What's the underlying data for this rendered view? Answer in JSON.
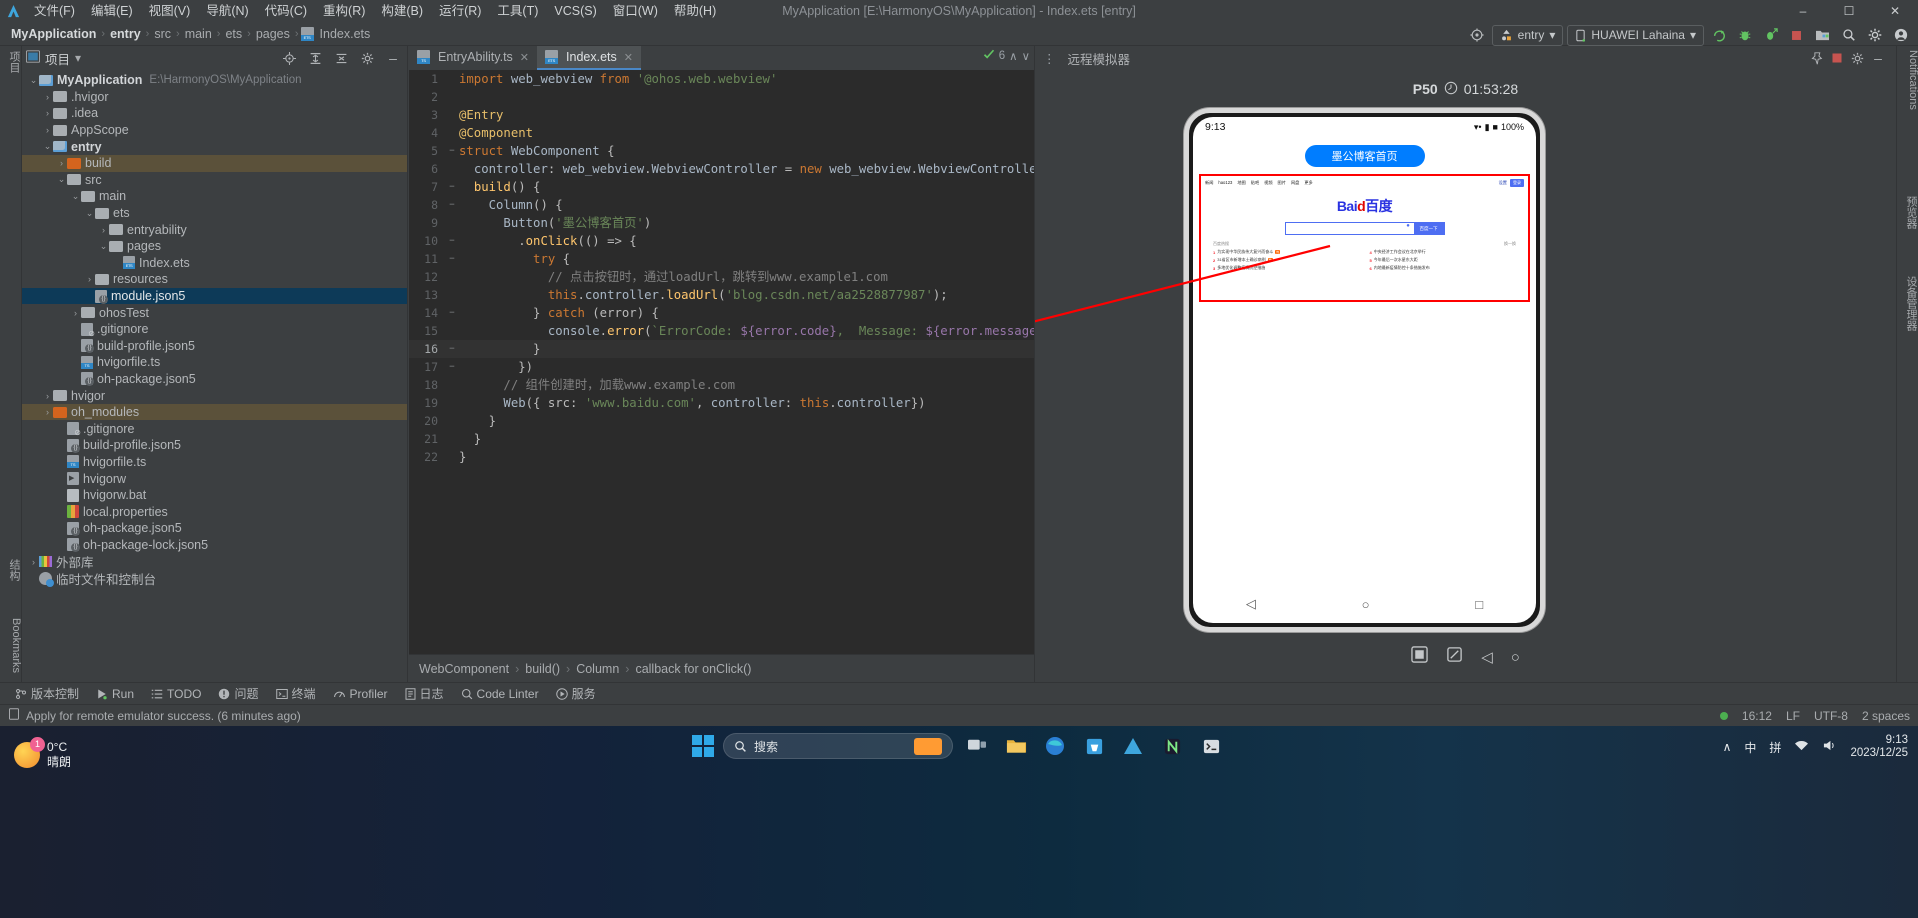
{
  "window": {
    "title": "MyApplication [E:\\HarmonyOS\\MyApplication] - Index.ets [entry]",
    "minimize": "–",
    "maximize": "☐",
    "close": "✕"
  },
  "menu": {
    "items": [
      "文件(F)",
      "编辑(E)",
      "视图(V)",
      "导航(N)",
      "代码(C)",
      "重构(R)",
      "构建(B)",
      "运行(R)",
      "工具(T)",
      "VCS(S)",
      "窗口(W)",
      "帮助(H)"
    ]
  },
  "breadcrumb": {
    "items": [
      "MyApplication",
      "entry",
      "src",
      "main",
      "ets",
      "pages"
    ],
    "file": "Index.ets",
    "separator": "›"
  },
  "toolbar": {
    "target_icon": "target-icon",
    "module": "entry",
    "device": "HUAWEI Lahaina",
    "run": "run-icon",
    "debug": "debug-icon",
    "profile": "profile-icon",
    "stop": "stop-icon",
    "device_manager": "device-manager-icon",
    "search": "search-icon",
    "settings": "gear-icon",
    "account": "account-icon",
    "chevron": "▾"
  },
  "project": {
    "title": "项目",
    "chevron": "▾",
    "actions": [
      "locate-icon",
      "expand-all-icon",
      "collapse-all-icon",
      "gear-icon",
      "minimize-icon"
    ],
    "tree": [
      {
        "indent": 0,
        "arrow": "⌄",
        "icon": "module",
        "label": "MyApplication",
        "bold": true,
        "path": "E:\\HarmonyOS\\MyApplication"
      },
      {
        "indent": 1,
        "arrow": "›",
        "icon": "folder",
        "label": ".hvigor"
      },
      {
        "indent": 1,
        "arrow": "›",
        "icon": "folder",
        "label": ".idea"
      },
      {
        "indent": 1,
        "arrow": "›",
        "icon": "folder",
        "label": "AppScope"
      },
      {
        "indent": 1,
        "arrow": "⌄",
        "icon": "module",
        "label": "entry",
        "bold": true
      },
      {
        "indent": 2,
        "arrow": "›",
        "icon": "folder-excluded",
        "label": "build",
        "highlight": true
      },
      {
        "indent": 2,
        "arrow": "⌄",
        "icon": "folder",
        "label": "src"
      },
      {
        "indent": 3,
        "arrow": "⌄",
        "icon": "folder",
        "label": "main"
      },
      {
        "indent": 4,
        "arrow": "⌄",
        "icon": "folder",
        "label": "ets"
      },
      {
        "indent": 5,
        "arrow": "›",
        "icon": "folder",
        "label": "entryability"
      },
      {
        "indent": 5,
        "arrow": "⌄",
        "icon": "folder",
        "label": "pages"
      },
      {
        "indent": 6,
        "arrow": "",
        "icon": "ets-file",
        "label": "Index.ets"
      },
      {
        "indent": 4,
        "arrow": "›",
        "icon": "folder",
        "label": "resources"
      },
      {
        "indent": 4,
        "arrow": "",
        "icon": "json5-file",
        "label": "module.json5",
        "selected": true
      },
      {
        "indent": 3,
        "arrow": "›",
        "icon": "folder",
        "label": "ohosTest"
      },
      {
        "indent": 3,
        "arrow": "",
        "icon": "gitignore-file",
        "label": ".gitignore"
      },
      {
        "indent": 3,
        "arrow": "",
        "icon": "json5-file",
        "label": "build-profile.json5"
      },
      {
        "indent": 3,
        "arrow": "",
        "icon": "ts-file",
        "label": "hvigorfile.ts"
      },
      {
        "indent": 3,
        "arrow": "",
        "icon": "json5-file",
        "label": "oh-package.json5"
      },
      {
        "indent": 1,
        "arrow": "›",
        "icon": "folder",
        "label": "hvigor"
      },
      {
        "indent": 1,
        "arrow": "›",
        "icon": "folder-excluded",
        "label": "oh_modules",
        "highlight": true
      },
      {
        "indent": 2,
        "arrow": "",
        "icon": "gitignore-file",
        "label": ".gitignore"
      },
      {
        "indent": 2,
        "arrow": "",
        "icon": "json5-file",
        "label": "build-profile.json5"
      },
      {
        "indent": 2,
        "arrow": "",
        "icon": "ts-file",
        "label": "hvigorfile.ts"
      },
      {
        "indent": 2,
        "arrow": "",
        "icon": "run-file",
        "label": "hvigorw"
      },
      {
        "indent": 2,
        "arrow": "",
        "icon": "bat-file",
        "label": "hvigorw.bat"
      },
      {
        "indent": 2,
        "arrow": "",
        "icon": "properties-file",
        "label": "local.properties"
      },
      {
        "indent": 2,
        "arrow": "",
        "icon": "json5-file",
        "label": "oh-package.json5"
      },
      {
        "indent": 2,
        "arrow": "",
        "icon": "json5-file",
        "label": "oh-package-lock.json5"
      },
      {
        "indent": 0,
        "arrow": "›",
        "icon": "library",
        "label": "外部库"
      },
      {
        "indent": 0,
        "arrow": "",
        "icon": "scratch",
        "label": "临时文件和控制台"
      }
    ]
  },
  "left_rail": {
    "project_label": "项目",
    "structure_label": "结构",
    "bookmarks_label": "Bookmarks"
  },
  "right_rail": {
    "notifications": "Notifications",
    "previewer": "预览器",
    "dev_eco": "设备管理器"
  },
  "editor": {
    "tabs": [
      {
        "label": "EntryAbility.ts",
        "icon": "ts-file",
        "active": false
      },
      {
        "label": "Index.ets",
        "icon": "ets-file",
        "active": true
      }
    ],
    "close_glyph": "✕",
    "inspections": {
      "icon": "inspection-icon",
      "count": "6",
      "up": "∧",
      "down": "∨"
    },
    "current_line": 16,
    "lines": [
      {
        "n": 1,
        "fold": "",
        "text": "import web_webview from '@ohos.web.webview'"
      },
      {
        "n": 2,
        "fold": "",
        "text": ""
      },
      {
        "n": 3,
        "fold": "",
        "text": "@Entry"
      },
      {
        "n": 4,
        "fold": "",
        "text": "@Component"
      },
      {
        "n": 5,
        "fold": "−",
        "text": "struct WebComponent {"
      },
      {
        "n": 6,
        "fold": "",
        "text": "  controller: web_webview.WebviewController = new web_webview.WebviewController()"
      },
      {
        "n": 7,
        "fold": "−",
        "text": "  build() {"
      },
      {
        "n": 8,
        "fold": "−",
        "text": "    Column() {"
      },
      {
        "n": 9,
        "fold": "",
        "text": "      Button('墨公博客首页')"
      },
      {
        "n": 10,
        "fold": "−",
        "text": "        .onClick(() => {"
      },
      {
        "n": 11,
        "fold": "−",
        "text": "          try {"
      },
      {
        "n": 12,
        "fold": "",
        "text": "            // 点击按钮时，通过loadUrl，跳转到www.example1.com"
      },
      {
        "n": 13,
        "fold": "",
        "text": "            this.controller.loadUrl('blog.csdn.net/aa2528877987');"
      },
      {
        "n": 14,
        "fold": "−",
        "text": "          } catch (error) {"
      },
      {
        "n": 15,
        "fold": "",
        "text": "            console.error(`ErrorCode: ${error.code},  Message: ${error.message}`);"
      },
      {
        "n": 16,
        "fold": "−",
        "text": "          }"
      },
      {
        "n": 17,
        "fold": "−",
        "text": "        })"
      },
      {
        "n": 18,
        "fold": "",
        "text": "      // 组件创建时，加载www.example.com"
      },
      {
        "n": 19,
        "fold": "",
        "text": "      Web({ src: 'www.baidu.com', controller: this.controller})"
      },
      {
        "n": 20,
        "fold": "",
        "text": "    }"
      },
      {
        "n": 21,
        "fold": "",
        "text": "  }"
      },
      {
        "n": 22,
        "fold": "",
        "text": "}"
      }
    ],
    "status_breadcrumb": [
      "WebComponent",
      "build()",
      "Column",
      "callback for onClick()"
    ],
    "status_separator": "›"
  },
  "emulator": {
    "header": "远程模拟器",
    "more_icon": "more-vertical-icon",
    "pin_icon": "pin-icon",
    "stop_icon": "stop-icon",
    "settings_icon": "gear-icon",
    "minimize_icon": "minimize-icon",
    "device_model": "P50",
    "timer_icon": "timer-icon",
    "time_remaining": "01:53:28",
    "phone": {
      "status_time": "9:13",
      "status_icons": [
        "wifi-icon",
        "signal-icon",
        "battery-icon"
      ],
      "battery": "100%",
      "button_label": "墨公博客首页",
      "nav": {
        "back": "◁",
        "home": "○",
        "recents": "□"
      }
    },
    "webpage": {
      "brand": {
        "part1": "Bai",
        "part2": "d",
        "part3": "百度"
      },
      "topnav": [
        "新闻",
        "hao123",
        "地图",
        "贴吧",
        "视频",
        "图片",
        "网盘",
        "更多"
      ],
      "topright": [
        "设置",
        "登录"
      ],
      "search_button": "百度一下",
      "news_header": "百度热搜",
      "news_more": "换一换",
      "news_left": [
        {
          "rank": "1",
          "text": "为实现中华民族伟大复兴而奋斗",
          "hot": "热"
        },
        {
          "rank": "2",
          "text": "31省区市新增本土确诊病例",
          "hot": "热"
        },
        {
          "rank": "3",
          "text": "多地优化调整疫情防控措施",
          "hot": ""
        }
      ],
      "news_right": [
        {
          "rank": "4",
          "text": "中央经济工作会议在北京举行",
          "hot": ""
        },
        {
          "rank": "5",
          "text": "今年最后一次水星东大距",
          "hot": ""
        },
        {
          "rank": "6",
          "text": "内地最新疫情防控十条措施发布",
          "hot": ""
        }
      ]
    },
    "tools": [
      "screenshot-icon",
      "rotate-icon",
      "back-icon",
      "home-icon"
    ]
  },
  "toolwindows": [
    {
      "icon": "vcs-icon",
      "label": "版本控制"
    },
    {
      "icon": "run-icon",
      "label": "Run"
    },
    {
      "icon": "todo-icon",
      "label": "TODO"
    },
    {
      "icon": "problems-icon",
      "label": "问题"
    },
    {
      "icon": "terminal-icon",
      "label": "终端"
    },
    {
      "icon": "profiler-icon",
      "label": "Profiler"
    },
    {
      "icon": "log-icon",
      "label": "日志"
    },
    {
      "icon": "code-linter-icon",
      "label": "Code Linter"
    },
    {
      "icon": "services-icon",
      "label": "服务"
    }
  ],
  "status_bar": {
    "message_icon": "event-log-icon",
    "message": "Apply for remote emulator success. (6 minutes ago)",
    "indicator": "green-dot",
    "time": "16:12",
    "line_separator": "LF",
    "encoding": "UTF-8",
    "indent": "2 spaces"
  },
  "taskbar": {
    "weather": {
      "temperature": "0°C",
      "condition": "晴朗",
      "badge": "1"
    },
    "start_icon": "windows-start-icon",
    "search_placeholder": "搜索",
    "search_icon": "search-icon",
    "apps": [
      "task-view-icon",
      "file-explorer-icon",
      "edge-icon",
      "store-icon",
      "deveco-icon",
      "n-app-icon",
      "terminal-icon"
    ],
    "tray": {
      "chevron": "∧",
      "ime_lang": "中",
      "ime_mode": "拼",
      "network": "network-icon",
      "volume": "volume-icon"
    },
    "clock": {
      "time": "9:13",
      "date": "2023/12/25"
    }
  },
  "colors": {
    "accent": "#4a88c7",
    "selection": "#0d3a58",
    "highlight": "#5b513a",
    "annotation_red": "#ff0000",
    "button_blue": "#007dff",
    "green": "#4caf50"
  }
}
